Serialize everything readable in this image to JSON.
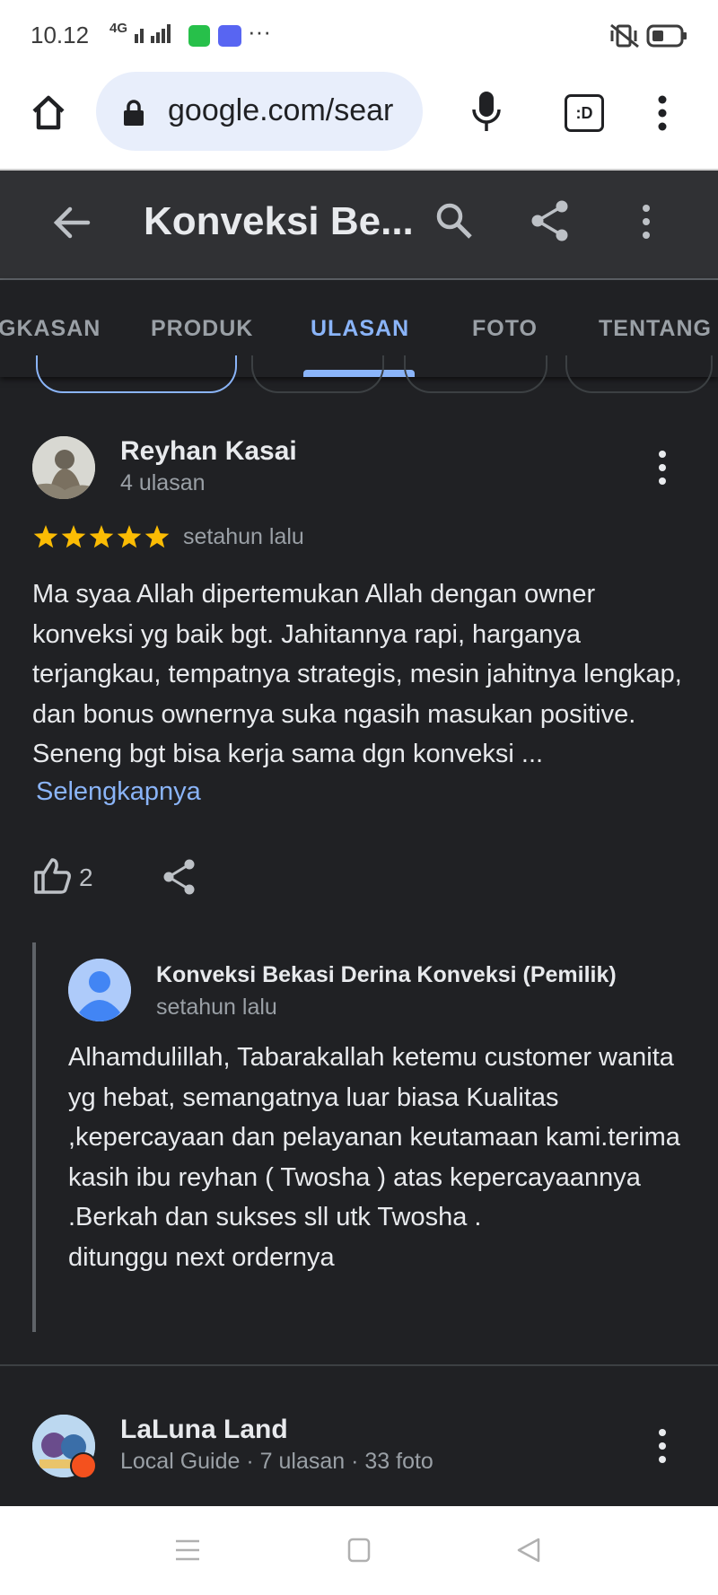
{
  "status_bar": {
    "time": "10.12",
    "network": "4G",
    "icons": [
      "signal-icon",
      "whatsapp-icon",
      "discord-icon",
      "more-dots-icon",
      "vibrate-icon",
      "battery-icon"
    ]
  },
  "browser": {
    "url": "google.com/sear",
    "tab_count": ":D",
    "icons": [
      "home-icon",
      "lock-icon",
      "mic-icon",
      "menu-icon"
    ]
  },
  "header": {
    "title": "Konveksi Be..."
  },
  "tabs": [
    "GKASAN",
    "PRODUK",
    "ULASAN",
    "FOTO",
    "TENTANG"
  ],
  "active_tab": "ULASAN",
  "reviews": [
    {
      "name": "Reyhan Kasai",
      "count": "4 ulasan",
      "rating": 5,
      "time": "setahun lalu",
      "text": "Ma syaa Allah dipertemukan Allah dengan owner konveksi yg baik bgt. Jahitannya rapi, harganya terjangkau, tempatnya strategis, mesin jahitnya lengkap, dan bonus ownernya suka ngasih masukan positive. Seneng bgt bisa kerja sama dgn konveksi ...",
      "more_label": "Selengkapnya",
      "likes": "2",
      "owner_reply": {
        "name": "Konveksi Bekasi Derina Konveksi (Pemilik)",
        "time": "setahun lalu",
        "text": "Alhamdulillah, Tabarakallah ketemu customer wanita yg hebat, semangatnya luar biasa Kualitas ,kepercayaan dan pelayanan keutamaan kami.terima kasih ibu reyhan ( Twosha ) atas kepercayaannya .Berkah dan sukses sll utk Twosha .\nditunggu next ordernya"
      }
    },
    {
      "name": "LaLuna Land",
      "meta": "Local Guide · 7 ulasan · 33 foto"
    }
  ],
  "colors": {
    "accent": "#8ab4f8",
    "star": "#fbbc04",
    "background": "#202124"
  }
}
